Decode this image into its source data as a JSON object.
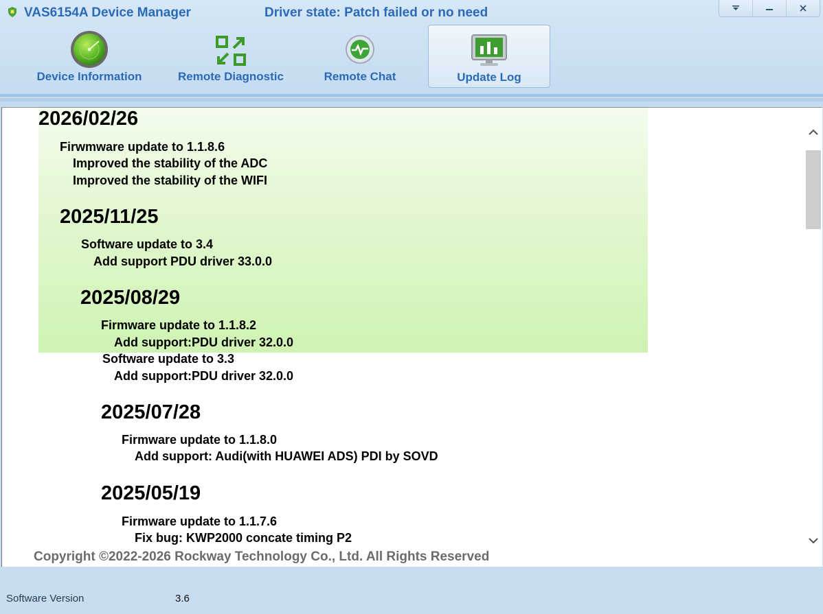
{
  "window": {
    "title": "VAS6154A Device Manager",
    "driver_state": "Driver state: Patch failed or no need",
    "controls": {
      "menu": "▾",
      "minimize": "–",
      "close": "✕"
    }
  },
  "tabs": [
    {
      "label": "Device Information",
      "icon": "radar-icon",
      "active": false
    },
    {
      "label": "Remote Diagnostic",
      "icon": "remote-arrows-icon",
      "active": false
    },
    {
      "label": "Remote Chat",
      "icon": "heartbeat-chat-icon",
      "active": false
    },
    {
      "label": "Update Log",
      "icon": "monitor-chart-icon",
      "active": true
    }
  ],
  "log": [
    {
      "date": "2026/02/26",
      "lines": [
        "Firwmware update to 1.1.8.6",
        "Improved the stability of the ADC",
        "Improved the stability of the WIFI"
      ]
    },
    {
      "date": "2025/11/25",
      "lines": [
        "Software update to 3.4",
        "Add support PDU driver 33.0.0"
      ]
    },
    {
      "date": "2025/08/29",
      "lines": [
        "Firmware update to 1.1.8.2",
        "Add support:PDU driver 32.0.0",
        "Software update to 3.3",
        "Add support:PDU driver 32.0.0"
      ]
    },
    {
      "date": "2025/07/28",
      "lines": [
        "Firmware update to 1.1.8.0",
        "Add support: Audi(with HUAWEI ADS) PDI by SOVD"
      ]
    },
    {
      "date": "2025/05/19",
      "lines": [
        "Firmware update to 1.1.7.6",
        "Fix bug: KWP2000 concate timing P2"
      ]
    }
  ],
  "copyright": "Copyright ©2022-2026 Rockway Technology Co., Ltd. All Rights Reserved",
  "footer": {
    "version_label": "Software Version",
    "version_value": "3.6"
  },
  "colors": {
    "title_blue": "#2a6ab7",
    "highlight_green": "#cff3b3",
    "panel_bg": "#c9ddf0"
  }
}
